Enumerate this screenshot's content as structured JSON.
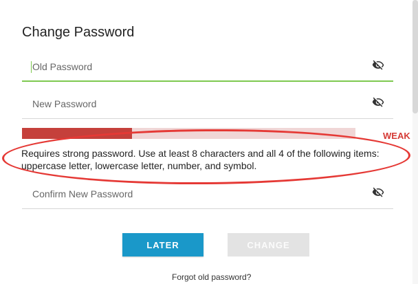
{
  "dialog": {
    "title": "Change Password"
  },
  "fields": {
    "old_password": {
      "label": "Old Password",
      "focused": true,
      "icon": "eye-off-icon"
    },
    "new_password": {
      "label": "New Password",
      "icon": "eye-off-icon"
    },
    "confirm_password": {
      "label": "Confirm New Password",
      "icon": "eye-off-icon"
    }
  },
  "strength": {
    "label": "WEAK",
    "level": 0.33,
    "color": "#c5403b",
    "track_color": "#f0d6d6"
  },
  "requirements": {
    "text": "Requires strong password. Use at least 8 characters and all 4 of the following items: uppercase letter, lowercase letter, number, and symbol."
  },
  "buttons": {
    "later": "LATER",
    "change": "CHANGE"
  },
  "links": {
    "forgot": "Forgot old password?"
  },
  "colors": {
    "accent_blue": "#1a98c9",
    "focus_green": "#7dc84f",
    "warning_red": "#d53a35"
  }
}
